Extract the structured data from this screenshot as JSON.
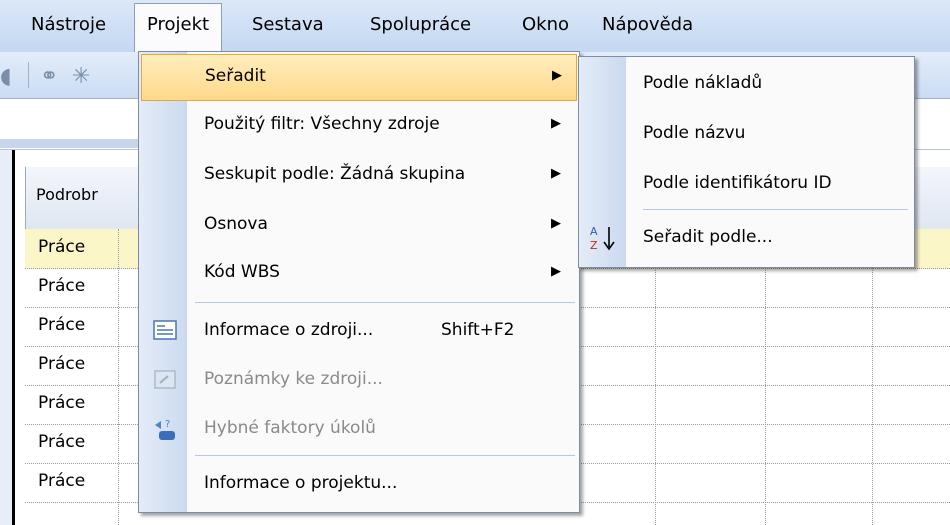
{
  "menubar": {
    "items": [
      "Nástroje",
      "Projekt",
      "Sestava",
      "Spolupráce",
      "Okno",
      "Nápověda"
    ],
    "active": "Projekt"
  },
  "sheet": {
    "column_header": "Podrobr",
    "rows": [
      "Práce",
      "Práce",
      "Práce",
      "Práce",
      "Práce",
      "Práce",
      "Práce"
    ]
  },
  "project_menu": {
    "items": [
      {
        "label": "Seřadit",
        "submenu": true,
        "highlighted": true
      },
      {
        "label": "Použitý filtr: Všechny zdroje",
        "submenu": true
      },
      {
        "label": "Seskupit podle: Žádná skupina",
        "submenu": true
      },
      {
        "label": "Osnova",
        "submenu": true
      },
      {
        "label": "Kód WBS",
        "submenu": true
      },
      {
        "label": "Informace o zdroji...",
        "shortcut": "Shift+F2",
        "icon": "resource-info-icon"
      },
      {
        "label": "Poznámky ke zdroji...",
        "disabled": true,
        "icon": "resource-notes-icon"
      },
      {
        "label": "Hybné faktory úkolů",
        "disabled": true,
        "icon": "task-drivers-icon"
      },
      {
        "label": "Informace o projektu..."
      }
    ]
  },
  "sort_submenu": {
    "items": [
      {
        "label": "Podle nákladů"
      },
      {
        "label": "Podle názvu"
      },
      {
        "label": "Podle identifikátoru ID"
      },
      {
        "label": "Seřadit podle...",
        "icon": "sort-az-icon"
      }
    ]
  },
  "colors": {
    "menu_highlight": "#ffd98a",
    "menubar_bg": "#c4d8f2",
    "selected_row": "#fbf6c8"
  }
}
